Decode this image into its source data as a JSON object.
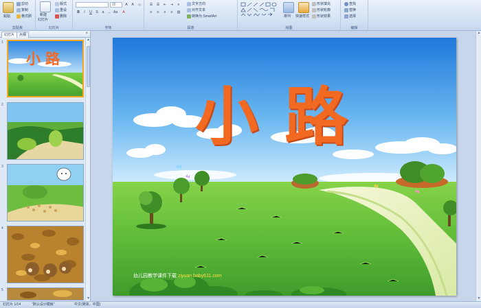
{
  "ribbon": {
    "clipboard": {
      "paste": "粘贴",
      "cut": "剪切",
      "copy": "复制",
      "format_painter": "格式刷",
      "label": "剪贴板"
    },
    "slides": {
      "new_slide": "新建",
      "new_slide_line2": "幻灯片",
      "layout": "版式",
      "reset": "重设",
      "delete": "删除",
      "label": "幻灯片"
    },
    "font": {
      "font_name": "",
      "font_size": "32",
      "label": "字体"
    },
    "paragraph": {
      "text_direction": "文字方向",
      "align_text": "对齐文本",
      "smartart": "转换为 SmartArt",
      "label": "段落"
    },
    "drawing": {
      "arrange": "排列",
      "quick_styles": "快速样式",
      "shape_fill": "形状填充",
      "shape_outline": "形状轮廓",
      "shape_effects": "形状效果",
      "label": "绘图"
    },
    "editing": {
      "find": "查找",
      "replace": "替换",
      "select": "选择",
      "label": "编辑"
    }
  },
  "panel": {
    "tab_slides": "幻灯片",
    "tab_outline": "大纲",
    "close": "×",
    "thumbs": [
      {
        "num": "1",
        "title": "小路"
      },
      {
        "num": "2"
      },
      {
        "num": "3"
      },
      {
        "num": "4"
      },
      {
        "num": "5"
      }
    ]
  },
  "slide": {
    "title": "小路",
    "watermark_text": "幼儿园教学课件下载",
    "watermark_url": "ziyuan.baby611.com"
  },
  "status": {
    "slide_of": "幻灯片 1/14",
    "theme": "\"默认设计模板\"",
    "language": "中文(简体，中国)"
  },
  "colors": {
    "ribbon_bg": "#d3e1f3",
    "title_orange": "#f26a22",
    "sky_top": "#2f86e0",
    "grass": "#5cb83a",
    "selected_border": "#f5a623"
  }
}
